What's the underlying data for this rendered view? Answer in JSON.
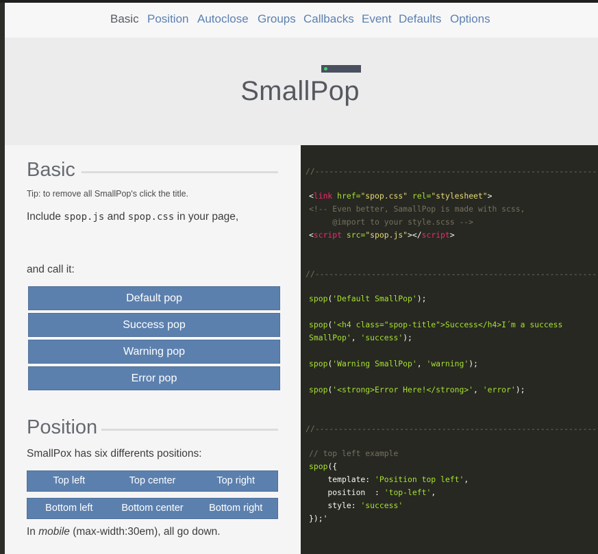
{
  "nav": {
    "items": [
      "Basic",
      "Position",
      "Autoclose",
      "Groups",
      "Callbacks",
      "Event",
      "Defaults",
      "Options"
    ],
    "active": "Basic"
  },
  "hero": {
    "title": "SmallPop"
  },
  "basic": {
    "title": "Basic",
    "tip": "Tip: to remove all SmallPop's click the title.",
    "include_pre": "Include ",
    "include_js": "spop.js",
    "include_and": " and ",
    "include_css": "spop.css",
    "include_post": " in your page,",
    "call_it": "and call it:",
    "buttons": [
      "Default pop",
      "Success pop",
      "Warning pop",
      "Error pop"
    ]
  },
  "position": {
    "title": "Position",
    "desc": "SmallPox has six differents positions:",
    "row1": [
      "Top left",
      "Top center",
      "Top right"
    ],
    "row2": [
      "Bottom left",
      "Bottom center",
      "Bottom right"
    ],
    "mobile_pre": "In ",
    "mobile_em": "mobile",
    "mobile_post": " (max-width:30em), all go down."
  },
  "code": {
    "separator": "//------------------------------------------------------------",
    "include": {
      "l1_a": "<",
      "l1_tag": "link",
      "l1_attr1": " href=",
      "l1_val1": "\"spop.css\"",
      "l1_attr2": " rel=",
      "l1_val2": "\"stylesheet\"",
      "l1_end": ">",
      "l2": "<!-- Even better, SamallPop is made with scss,",
      "l3": "     @import to your style.scss -->",
      "l4_a": "<",
      "l4_tag": "script",
      "l4_attr": " src=",
      "l4_val": "\"spop.js\"",
      "l4_mid": "></",
      "l4_tag2": "script",
      "l4_end": ">"
    },
    "basic": {
      "l1_fn": "spop",
      "l1_a": "(",
      "l1_s": "'Default SmallPop'",
      "l1_b": ");",
      "l2_fn": "spop",
      "l2_a": "(",
      "l2_s": "'<h4 class=\"spop-title\">Success</h4>I´m a success",
      "l3_s": "SmallPop'",
      "l3_b": ", ",
      "l3_s2": "'success'",
      "l3_c": ");",
      "l4_fn": "spop",
      "l4_a": "(",
      "l4_s": "'Warning SmallPop'",
      "l4_b": ", ",
      "l4_s2": "'warning'",
      "l4_c": ");",
      "l5_fn": "spop",
      "l5_a": "(",
      "l5_s": "'<strong>Error Here!</strong>'",
      "l5_b": ", ",
      "l5_s2": "'error'",
      "l5_c": ");"
    },
    "position": {
      "l1": "// top left example",
      "l2_fn": "spop",
      "l2_a": "({",
      "l3_k": "    template",
      "l3_b": ": ",
      "l3_s": "'Position top left'",
      "l3_c": ",",
      "l4_k": "    position",
      "l4_b": "  : ",
      "l4_s": "'top-left'",
      "l4_c": ",",
      "l5_k": "    style",
      "l5_b": ": ",
      "l5_s": "'success'",
      "l6": "});'"
    }
  },
  "colors": {
    "accent": "#5c80ae",
    "code_bg": "#272822",
    "logo_dot": "#3dd36b"
  }
}
